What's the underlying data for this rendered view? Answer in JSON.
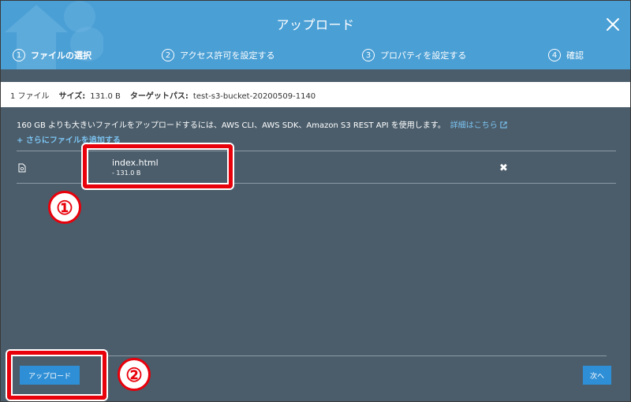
{
  "dialog": {
    "title": "アップロード",
    "close_icon": "close-icon"
  },
  "steps": [
    {
      "num": "1",
      "label": "ファイルの選択",
      "active": true
    },
    {
      "num": "2",
      "label": "アクセス許可を設定する",
      "active": false
    },
    {
      "num": "3",
      "label": "プロパティを設定する",
      "active": false
    },
    {
      "num": "4",
      "label": "確認",
      "active": false
    }
  ],
  "info_bar": {
    "file_count": "1 ファイル",
    "size_label": "サイズ:",
    "size_value": "131.0 B",
    "target_label": "ターゲットパス:",
    "target_value": "test-s3-bucket-20200509-1140"
  },
  "notice": {
    "text": "160 GB よりも大きいファイルをアップロードするには、AWS CLI、AWS SDK、Amazon S3 REST API を使用します。",
    "link": "詳細はこちら"
  },
  "add_files": "さらにファイルを追加する",
  "files": [
    {
      "name": "index.html",
      "size": "- 131.0 B"
    }
  ],
  "annotations": {
    "one": "①",
    "two": "②"
  },
  "footer": {
    "upload_label": "アップロード",
    "next_label": "次へ"
  },
  "colors": {
    "header": "#4a9fd5",
    "panel": "#4b5d6b",
    "button": "#2f8fd6",
    "link": "#7cc4f2",
    "callout": "#e8000b"
  }
}
